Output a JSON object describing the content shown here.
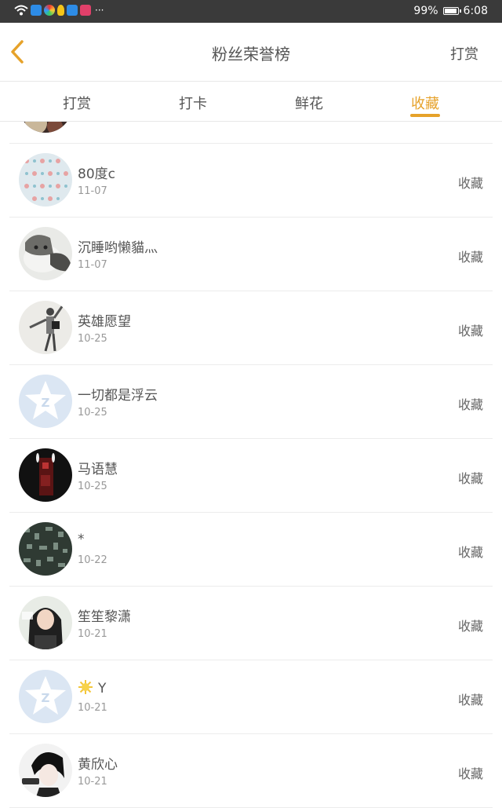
{
  "status_bar": {
    "battery": "99%",
    "battery_level": 0.99,
    "time": "6:08",
    "more_icons": "···"
  },
  "header": {
    "title": "粉丝荣誉榜",
    "right_label": "打赏"
  },
  "tabs": [
    {
      "label": "打赏",
      "active": false
    },
    {
      "label": "打卡",
      "active": false
    },
    {
      "label": "鲜花",
      "active": false
    },
    {
      "label": "收藏",
      "active": true
    }
  ],
  "accent_color": "#e6a22a",
  "list": {
    "partial_item": {
      "avatar": "dark-photo"
    },
    "items": [
      {
        "name": "80度c",
        "date": "11-07",
        "action": "收藏",
        "avatar": "pattern-photo"
      },
      {
        "name": "沉睡哟懒貓灬",
        "date": "11-07",
        "action": "收藏",
        "avatar": "cat-photo"
      },
      {
        "name": "英雄愿望",
        "date": "10-25",
        "action": "收藏",
        "avatar": "person-photo"
      },
      {
        "name": "一切都是浮云",
        "date": "10-25",
        "action": "收藏",
        "avatar": "default-qq-star"
      },
      {
        "name": "马语慧",
        "date": "10-25",
        "action": "收藏",
        "avatar": "dark-photo"
      },
      {
        "name": "*",
        "date": "10-22",
        "action": "收藏",
        "avatar": "texture-photo"
      },
      {
        "name": "笙笙黎潇",
        "date": "10-21",
        "action": "收藏",
        "avatar": "girl-photo"
      },
      {
        "name": "Y",
        "name_prefix_icon": "sun-icon",
        "date": "10-21",
        "action": "收藏",
        "avatar": "default-qq-star"
      },
      {
        "name": "黄欣心",
        "date": "10-21",
        "action": "收藏",
        "avatar": "anime-photo"
      }
    ]
  }
}
